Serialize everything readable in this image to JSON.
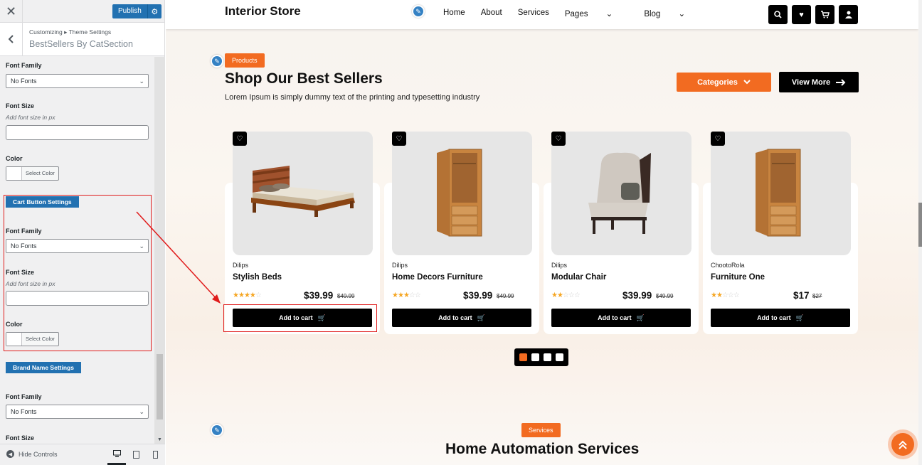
{
  "customizer": {
    "close_icon": "close-icon",
    "publish_label": "Publish",
    "breadcrumb": "Customizing ▸ Theme Settings",
    "section_title": "BestSellers By CatSection",
    "fields": {
      "top_font_family_label": "Font Family",
      "top_font_family_value": "No Fonts",
      "top_font_size_label": "Font Size",
      "top_font_size_desc": "Add font size in px",
      "top_color_label": "Color",
      "select_color": "Select Color",
      "cart_badge": "Cart Button Settings",
      "cart_font_family_label": "Font Family",
      "cart_font_family_value": "No Fonts",
      "cart_font_size_label": "Font Size",
      "cart_font_size_desc": "Add font size in px",
      "cart_color_label": "Color",
      "brand_badge": "Brand Name Settings",
      "brand_font_family_label": "Font Family",
      "brand_font_family_value": "No Fonts",
      "brand_font_size_label": "Font Size"
    },
    "hide_controls": "Hide Controls"
  },
  "site": {
    "logo": "Interior Store",
    "menu": [
      "Home",
      "About",
      "Services",
      "Pages",
      "Blog"
    ],
    "products_tag": "Products",
    "section_title": "Shop Our Best Sellers",
    "section_sub": "Lorem Ipsum is simply dummy text of the printing and typesetting industry",
    "categories_btn": "Categories",
    "view_more_btn": "View More",
    "products": [
      {
        "brand": "Dilips",
        "name": "Stylish Beds",
        "price": "$39.99",
        "old_price": "$49.99",
        "rating": 4,
        "cart": "Add to cart"
      },
      {
        "brand": "Dilips",
        "name": "Home Decors Furniture",
        "price": "$39.99",
        "old_price": "$49.99",
        "rating": 3,
        "cart": "Add to cart"
      },
      {
        "brand": "Dilips",
        "name": "Modular Chair",
        "price": "$39.99",
        "old_price": "$49.99",
        "rating": 2,
        "cart": "Add to cart"
      },
      {
        "brand": "ChootoRola",
        "name": "Furniture One",
        "price": "$17",
        "old_price": "$27",
        "rating": 2,
        "cart": "Add to cart"
      }
    ],
    "carousel_active": 1,
    "carousel_count": 4,
    "services_tag": "Services",
    "services_title": "Home Automation Services"
  },
  "colors": {
    "accent": "#f26b21",
    "wp_blue": "#2271b1",
    "annotation_red": "#e01b1b"
  }
}
